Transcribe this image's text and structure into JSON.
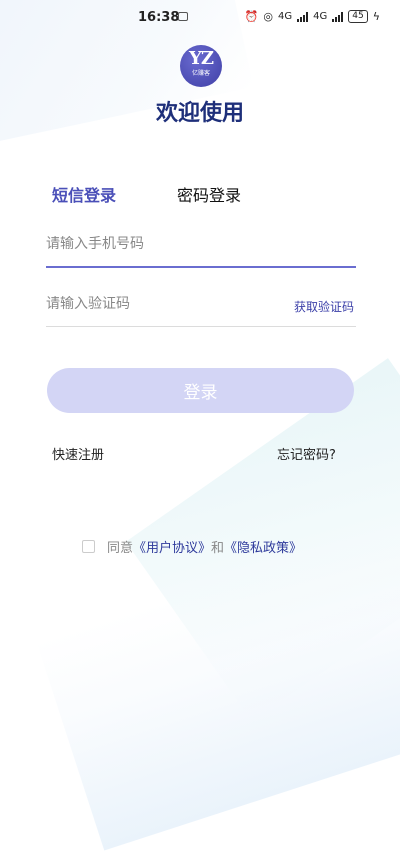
{
  "status_bar": {
    "time": "16:38",
    "network_1": "4G",
    "network_2": "4G",
    "battery": "45"
  },
  "logo": {
    "text": "YZ",
    "subtext": "亿赚客"
  },
  "welcome_title": "欢迎使用",
  "tabs": {
    "sms": "短信登录",
    "password": "密码登录"
  },
  "form": {
    "phone_placeholder": "请输入手机号码",
    "code_placeholder": "请输入验证码",
    "get_code": "获取验证码",
    "login": "登录"
  },
  "links": {
    "register": "快速注册",
    "forgot": "忘记密码?"
  },
  "agreement": {
    "prefix": "同意",
    "user_agreement": "《用户协议》",
    "conjunction": "和",
    "privacy_policy": "《隐私政策》"
  },
  "colors": {
    "accent": "#4a4fb8",
    "title": "#1e2f7a",
    "button_disabled": "#d3d5f5",
    "link": "#2f3b9c"
  }
}
